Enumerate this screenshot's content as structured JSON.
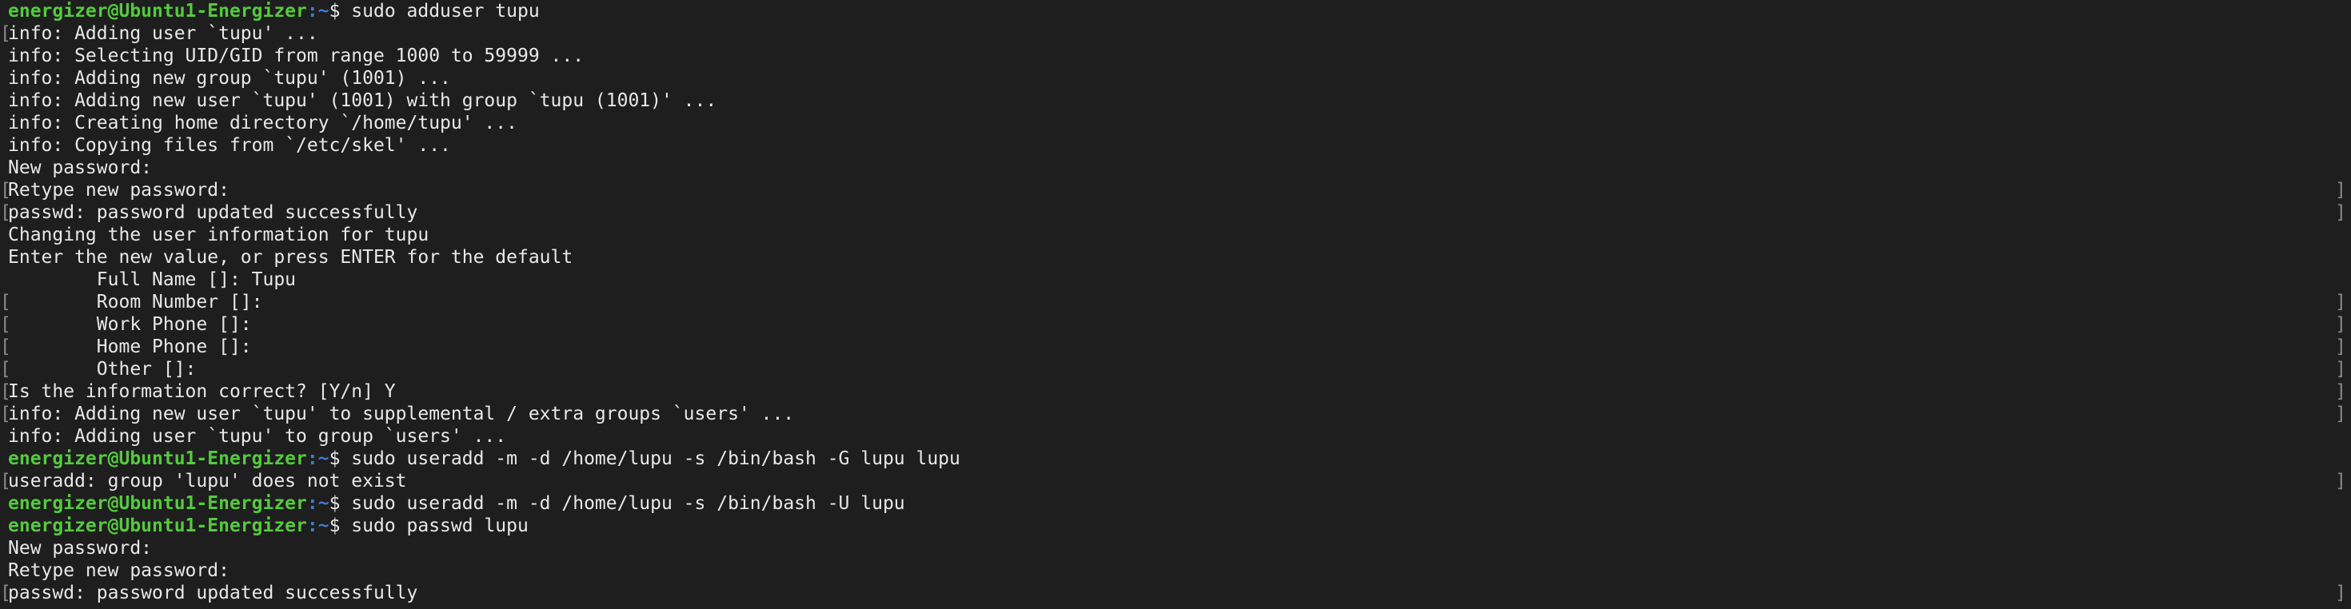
{
  "prompt": {
    "user_host": "energizer@Ubuntu1-Energizer",
    "path": ":~",
    "sign": "$ "
  },
  "markers": {
    "left": "[",
    "right": "]"
  },
  "lines": [
    {
      "kind": "cmd",
      "text": "sudo adduser tupu"
    },
    {
      "kind": "out",
      "text": "info: Adding user `tupu' ...",
      "left": true
    },
    {
      "kind": "out",
      "text": "info: Selecting UID/GID from range 1000 to 59999 ..."
    },
    {
      "kind": "out",
      "text": "info: Adding new group `tupu' (1001) ..."
    },
    {
      "kind": "out",
      "text": "info: Adding new user `tupu' (1001) with group `tupu (1001)' ..."
    },
    {
      "kind": "out",
      "text": "info: Creating home directory `/home/tupu' ..."
    },
    {
      "kind": "out",
      "text": "info: Copying files from `/etc/skel' ..."
    },
    {
      "kind": "out",
      "text": "New password:"
    },
    {
      "kind": "out",
      "text": "Retype new password:",
      "left": true,
      "right": true
    },
    {
      "kind": "out",
      "text": "passwd: password updated successfully",
      "left": true,
      "right": true
    },
    {
      "kind": "out",
      "text": "Changing the user information for tupu"
    },
    {
      "kind": "out",
      "text": "Enter the new value, or press ENTER for the default"
    },
    {
      "kind": "out",
      "text": "        Full Name []: Tupu"
    },
    {
      "kind": "out",
      "text": "        Room Number []:",
      "left": true,
      "right": true
    },
    {
      "kind": "out",
      "text": "        Work Phone []:",
      "left": true,
      "right": true
    },
    {
      "kind": "out",
      "text": "        Home Phone []:",
      "left": true,
      "right": true
    },
    {
      "kind": "out",
      "text": "        Other []:",
      "left": true,
      "right": true
    },
    {
      "kind": "out",
      "text": "Is the information correct? [Y/n] Y",
      "left": true,
      "right": true
    },
    {
      "kind": "out",
      "text": "info: Adding new user `tupu' to supplemental / extra groups `users' ...",
      "left": true,
      "right": true
    },
    {
      "kind": "out",
      "text": "info: Adding user `tupu' to group `users' ..."
    },
    {
      "kind": "cmd",
      "text": "sudo useradd -m -d /home/lupu -s /bin/bash -G lupu lupu"
    },
    {
      "kind": "out",
      "text": "useradd: group 'lupu' does not exist",
      "left": true,
      "right": true
    },
    {
      "kind": "cmd",
      "text": "sudo useradd -m -d /home/lupu -s /bin/bash -U lupu"
    },
    {
      "kind": "cmd",
      "text": "sudo passwd lupu"
    },
    {
      "kind": "out",
      "text": "New password:"
    },
    {
      "kind": "out",
      "text": "Retype new password:"
    },
    {
      "kind": "out",
      "text": "passwd: password updated successfully",
      "left": true,
      "right": true
    }
  ]
}
